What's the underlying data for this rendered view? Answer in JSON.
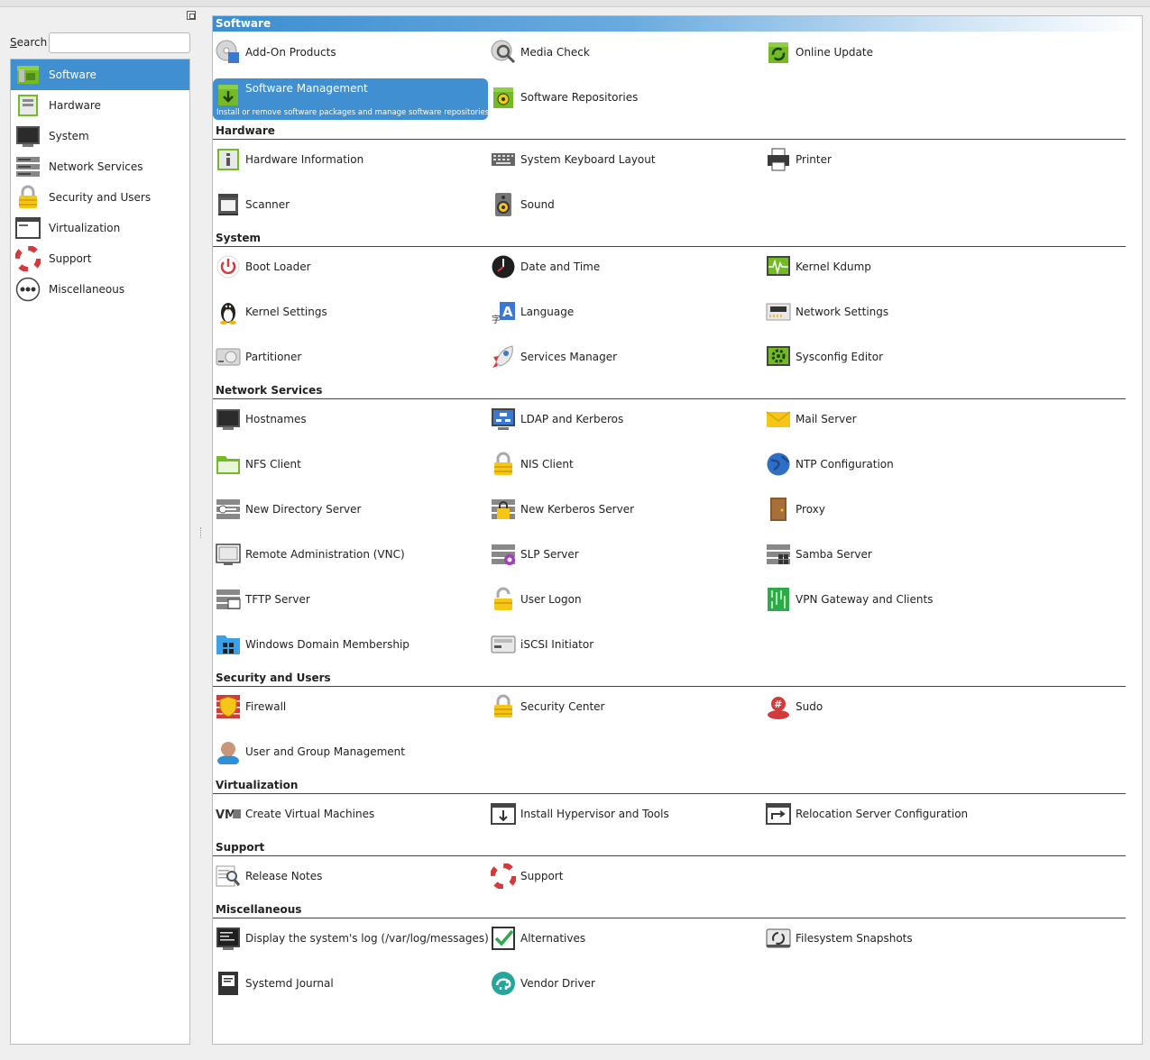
{
  "search": {
    "label_prefix": "",
    "label_accel": "S",
    "label_rest": "earch",
    "value": "",
    "placeholder": ""
  },
  "sidebar": {
    "items": [
      {
        "label": "Software",
        "icon": "package-box-icon",
        "selected": true
      },
      {
        "label": "Hardware",
        "icon": "hardware-board-icon",
        "selected": false
      },
      {
        "label": "System",
        "icon": "monitor-icon",
        "selected": false
      },
      {
        "label": "Network Services",
        "icon": "server-rack-icon",
        "selected": false
      },
      {
        "label": "Security and Users",
        "icon": "padlock-icon",
        "selected": false
      },
      {
        "label": "Virtualization",
        "icon": "window-icon",
        "selected": false
      },
      {
        "label": "Support",
        "icon": "lifebuoy-icon",
        "selected": false
      },
      {
        "label": "Miscellaneous",
        "icon": "ellipsis-circle-icon",
        "selected": false
      }
    ]
  },
  "categories": [
    {
      "title": "Software",
      "modules": [
        {
          "label": "Add-On Products",
          "icon": "cd-puzzle-icon"
        },
        {
          "label": "Media Check",
          "icon": "cd-magnifier-icon"
        },
        {
          "label": "Online Update",
          "icon": "box-refresh-icon"
        },
        {
          "label": "Software Management",
          "icon": "box-download-icon",
          "selected": true,
          "description": "Install or remove software packages and manage software repositories"
        },
        {
          "label": "Software Repositories",
          "icon": "box-cd-icon"
        }
      ]
    },
    {
      "title": "Hardware",
      "modules": [
        {
          "label": "Hardware Information",
          "icon": "info-board-icon"
        },
        {
          "label": "System Keyboard Layout",
          "icon": "keyboard-icon"
        },
        {
          "label": "Printer",
          "icon": "printer-icon"
        },
        {
          "label": "Scanner",
          "icon": "scanner-icon"
        },
        {
          "label": "Sound",
          "icon": "speaker-icon"
        }
      ]
    },
    {
      "title": "System",
      "modules": [
        {
          "label": "Boot Loader",
          "icon": "power-icon"
        },
        {
          "label": "Date and Time",
          "icon": "clock-icon"
        },
        {
          "label": "Kernel Kdump",
          "icon": "waveform-monitor-icon"
        },
        {
          "label": "Kernel Settings",
          "icon": "tux-penguin-icon"
        },
        {
          "label": "Language",
          "icon": "language-a-icon"
        },
        {
          "label": "Network Settings",
          "icon": "network-card-icon"
        },
        {
          "label": "Partitioner",
          "icon": "hard-disk-icon"
        },
        {
          "label": "Services Manager",
          "icon": "rocket-icon"
        },
        {
          "label": "Sysconfig Editor",
          "icon": "gear-monitor-icon"
        }
      ]
    },
    {
      "title": "Network Services",
      "modules": [
        {
          "label": "Hostnames",
          "icon": "monitor-icon"
        },
        {
          "label": "LDAP and Kerberos",
          "icon": "monitor-tree-icon"
        },
        {
          "label": "Mail Server",
          "icon": "envelope-icon"
        },
        {
          "label": "NFS Client",
          "icon": "green-folder-icon"
        },
        {
          "label": "NIS Client",
          "icon": "padlock-icon"
        },
        {
          "label": "NTP Configuration",
          "icon": "globe-icon"
        },
        {
          "label": "New Directory Server",
          "icon": "server-key-icon"
        },
        {
          "label": "New Kerberos Server",
          "icon": "server-lock-icon"
        },
        {
          "label": "Proxy",
          "icon": "door-icon"
        },
        {
          "label": "Remote Administration (VNC)",
          "icon": "remote-monitor-icon"
        },
        {
          "label": "SLP Server",
          "icon": "server-badge-icon"
        },
        {
          "label": "Samba Server",
          "icon": "server-windows-icon"
        },
        {
          "label": "TFTP Server",
          "icon": "server-monitor-icon"
        },
        {
          "label": "User Logon",
          "icon": "open-padlock-icon"
        },
        {
          "label": "VPN Gateway and Clients",
          "icon": "circuit-board-icon"
        },
        {
          "label": "Windows Domain Membership",
          "icon": "blue-folder-windows-icon"
        },
        {
          "label": "iSCSI Initiator",
          "icon": "disk-drive-icon"
        }
      ]
    },
    {
      "title": "Security and Users",
      "modules": [
        {
          "label": "Firewall",
          "icon": "firewall-shield-icon"
        },
        {
          "label": "Security Center",
          "icon": "padlock-icon"
        },
        {
          "label": "Sudo",
          "icon": "sudo-user-icon"
        },
        {
          "label": "User and Group Management",
          "icon": "user-avatar-icon"
        }
      ]
    },
    {
      "title": "Virtualization",
      "modules": [
        {
          "label": "Create Virtual Machines",
          "icon": "vm-logo-icon"
        },
        {
          "label": "Install Hypervisor and Tools",
          "icon": "window-download-icon"
        },
        {
          "label": "Relocation Server Configuration",
          "icon": "window-arrow-icon"
        }
      ]
    },
    {
      "title": "Support",
      "modules": [
        {
          "label": "Release Notes",
          "icon": "document-magnifier-icon"
        },
        {
          "label": "Support",
          "icon": "lifebuoy-icon"
        }
      ]
    },
    {
      "title": "Miscellaneous",
      "modules": [
        {
          "label": "Display the system's log (/var/log/messages)",
          "icon": "log-monitor-icon"
        },
        {
          "label": "Alternatives",
          "icon": "checkmark-icon"
        },
        {
          "label": "Filesystem Snapshots",
          "icon": "snapshot-icon"
        },
        {
          "label": "Systemd Journal",
          "icon": "journal-book-icon"
        },
        {
          "label": "Vendor Driver",
          "icon": "chameleon-icon"
        }
      ]
    }
  ],
  "colors": {
    "selection": "#3f8fd1",
    "accent_green": "#73ba25"
  }
}
